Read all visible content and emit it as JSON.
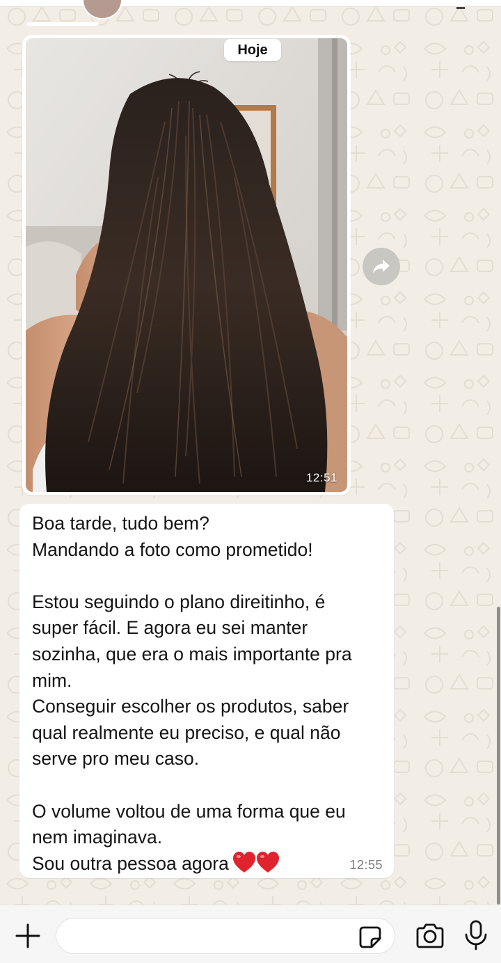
{
  "chat": {
    "date_pill": "Hoje",
    "photo_message": {
      "time": "12:51"
    },
    "text_message": {
      "lines": [
        "Boa tarde, tudo bem?",
        "Mandando a foto como prometido!",
        "",
        "Estou seguindo o plano direitinho, é",
        "super fácil. E agora eu sei manter",
        "sozinha, que era o mais importante pra",
        "mim.",
        "Conseguir escolher os produtos, saber",
        "qual realmente eu preciso, e qual não",
        "serve pro meu caso.",
        "",
        "O volume voltou de uma forma que eu",
        "nem imaginava.",
        "Sou outra pessoa agora"
      ],
      "emoji": "❤️❤️",
      "time": "12:55"
    }
  },
  "input_bar": {
    "placeholder": "",
    "icons": [
      "plus-icon",
      "sticker-icon",
      "camera-icon",
      "microphone-icon"
    ]
  },
  "colors": {
    "wallpaper": "#f2ede5",
    "bubble": "#ffffff",
    "heart": "#e0242f"
  }
}
